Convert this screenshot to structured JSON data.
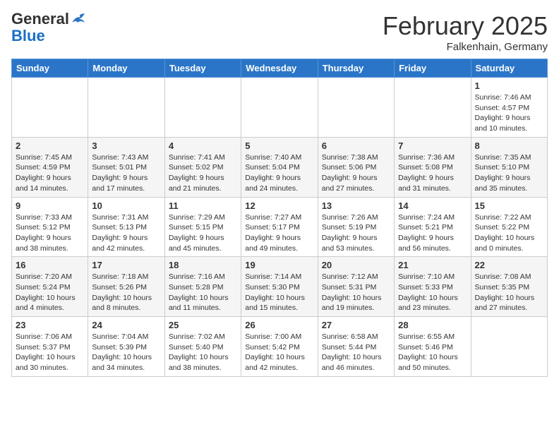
{
  "logo": {
    "general": "General",
    "blue": "Blue"
  },
  "header": {
    "month": "February 2025",
    "location": "Falkenhain, Germany"
  },
  "weekdays": [
    "Sunday",
    "Monday",
    "Tuesday",
    "Wednesday",
    "Thursday",
    "Friday",
    "Saturday"
  ],
  "weeks": [
    [
      {
        "day": "",
        "info": ""
      },
      {
        "day": "",
        "info": ""
      },
      {
        "day": "",
        "info": ""
      },
      {
        "day": "",
        "info": ""
      },
      {
        "day": "",
        "info": ""
      },
      {
        "day": "",
        "info": ""
      },
      {
        "day": "1",
        "info": "Sunrise: 7:46 AM\nSunset: 4:57 PM\nDaylight: 9 hours and 10 minutes."
      }
    ],
    [
      {
        "day": "2",
        "info": "Sunrise: 7:45 AM\nSunset: 4:59 PM\nDaylight: 9 hours and 14 minutes."
      },
      {
        "day": "3",
        "info": "Sunrise: 7:43 AM\nSunset: 5:01 PM\nDaylight: 9 hours and 17 minutes."
      },
      {
        "day": "4",
        "info": "Sunrise: 7:41 AM\nSunset: 5:02 PM\nDaylight: 9 hours and 21 minutes."
      },
      {
        "day": "5",
        "info": "Sunrise: 7:40 AM\nSunset: 5:04 PM\nDaylight: 9 hours and 24 minutes."
      },
      {
        "day": "6",
        "info": "Sunrise: 7:38 AM\nSunset: 5:06 PM\nDaylight: 9 hours and 27 minutes."
      },
      {
        "day": "7",
        "info": "Sunrise: 7:36 AM\nSunset: 5:08 PM\nDaylight: 9 hours and 31 minutes."
      },
      {
        "day": "8",
        "info": "Sunrise: 7:35 AM\nSunset: 5:10 PM\nDaylight: 9 hours and 35 minutes."
      }
    ],
    [
      {
        "day": "9",
        "info": "Sunrise: 7:33 AM\nSunset: 5:12 PM\nDaylight: 9 hours and 38 minutes."
      },
      {
        "day": "10",
        "info": "Sunrise: 7:31 AM\nSunset: 5:13 PM\nDaylight: 9 hours and 42 minutes."
      },
      {
        "day": "11",
        "info": "Sunrise: 7:29 AM\nSunset: 5:15 PM\nDaylight: 9 hours and 45 minutes."
      },
      {
        "day": "12",
        "info": "Sunrise: 7:27 AM\nSunset: 5:17 PM\nDaylight: 9 hours and 49 minutes."
      },
      {
        "day": "13",
        "info": "Sunrise: 7:26 AM\nSunset: 5:19 PM\nDaylight: 9 hours and 53 minutes."
      },
      {
        "day": "14",
        "info": "Sunrise: 7:24 AM\nSunset: 5:21 PM\nDaylight: 9 hours and 56 minutes."
      },
      {
        "day": "15",
        "info": "Sunrise: 7:22 AM\nSunset: 5:22 PM\nDaylight: 10 hours and 0 minutes."
      }
    ],
    [
      {
        "day": "16",
        "info": "Sunrise: 7:20 AM\nSunset: 5:24 PM\nDaylight: 10 hours and 4 minutes."
      },
      {
        "day": "17",
        "info": "Sunrise: 7:18 AM\nSunset: 5:26 PM\nDaylight: 10 hours and 8 minutes."
      },
      {
        "day": "18",
        "info": "Sunrise: 7:16 AM\nSunset: 5:28 PM\nDaylight: 10 hours and 11 minutes."
      },
      {
        "day": "19",
        "info": "Sunrise: 7:14 AM\nSunset: 5:30 PM\nDaylight: 10 hours and 15 minutes."
      },
      {
        "day": "20",
        "info": "Sunrise: 7:12 AM\nSunset: 5:31 PM\nDaylight: 10 hours and 19 minutes."
      },
      {
        "day": "21",
        "info": "Sunrise: 7:10 AM\nSunset: 5:33 PM\nDaylight: 10 hours and 23 minutes."
      },
      {
        "day": "22",
        "info": "Sunrise: 7:08 AM\nSunset: 5:35 PM\nDaylight: 10 hours and 27 minutes."
      }
    ],
    [
      {
        "day": "23",
        "info": "Sunrise: 7:06 AM\nSunset: 5:37 PM\nDaylight: 10 hours and 30 minutes."
      },
      {
        "day": "24",
        "info": "Sunrise: 7:04 AM\nSunset: 5:39 PM\nDaylight: 10 hours and 34 minutes."
      },
      {
        "day": "25",
        "info": "Sunrise: 7:02 AM\nSunset: 5:40 PM\nDaylight: 10 hours and 38 minutes."
      },
      {
        "day": "26",
        "info": "Sunrise: 7:00 AM\nSunset: 5:42 PM\nDaylight: 10 hours and 42 minutes."
      },
      {
        "day": "27",
        "info": "Sunrise: 6:58 AM\nSunset: 5:44 PM\nDaylight: 10 hours and 46 minutes."
      },
      {
        "day": "28",
        "info": "Sunrise: 6:55 AM\nSunset: 5:46 PM\nDaylight: 10 hours and 50 minutes."
      },
      {
        "day": "",
        "info": ""
      }
    ]
  ]
}
